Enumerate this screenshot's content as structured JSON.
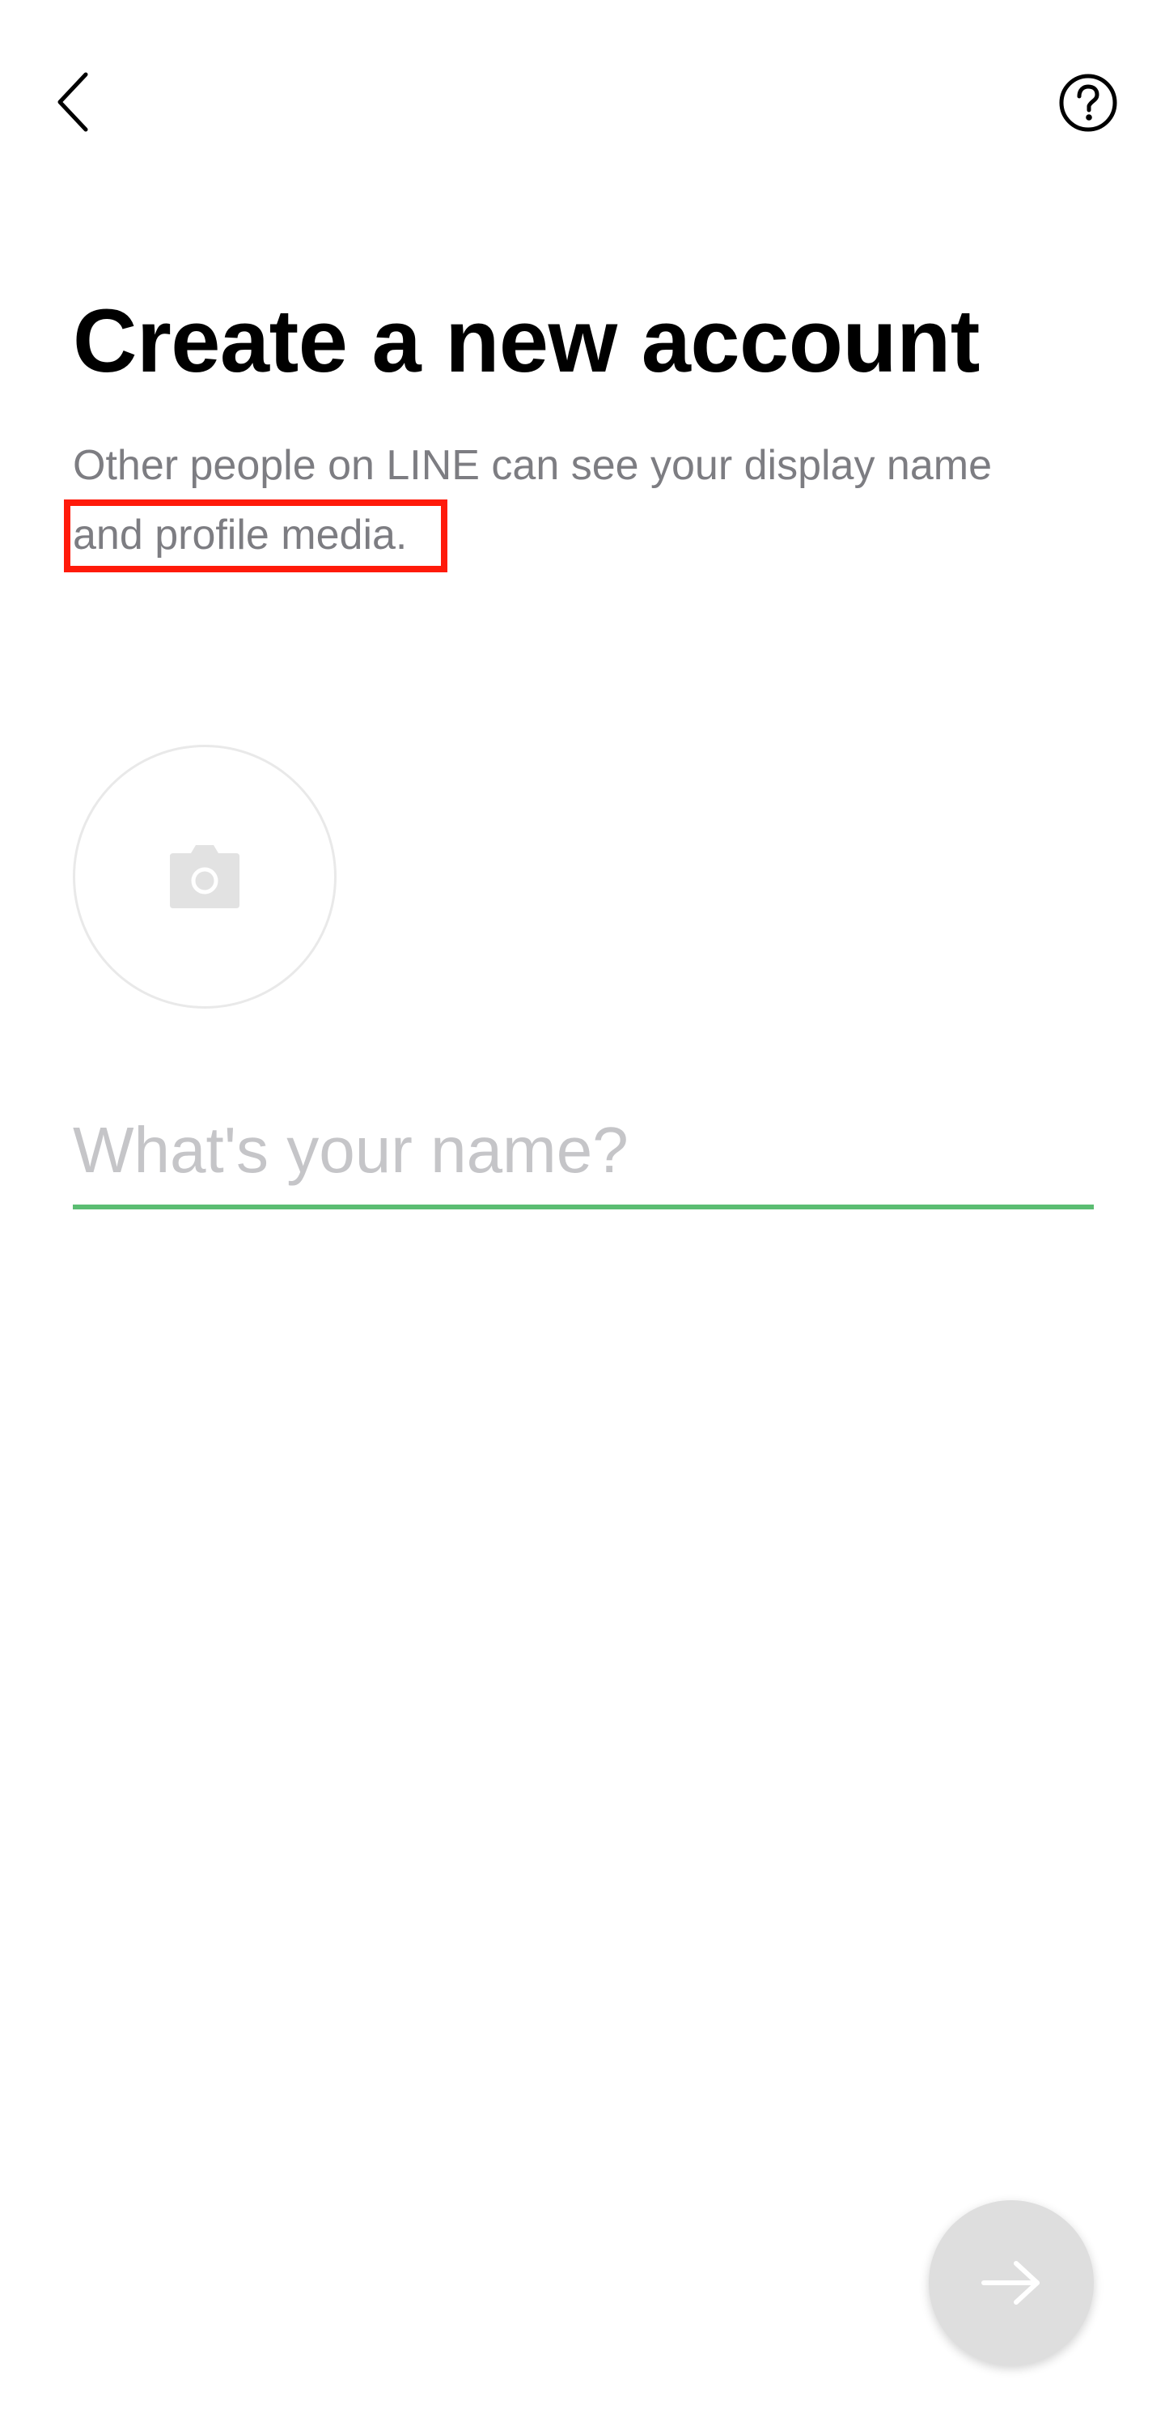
{
  "header": {
    "back_icon": "chevron-left-icon",
    "help_icon": "question-circle-icon"
  },
  "title": "Create a new account",
  "subtitle": {
    "line1": "Other people on LINE can see your display name",
    "line2": "and profile media."
  },
  "avatar": {
    "icon": "camera-icon"
  },
  "name_field": {
    "value": "",
    "placeholder": "What's your name?"
  },
  "next_button": {
    "icon": "arrow-right-icon",
    "enabled": false
  },
  "colors": {
    "accent_green": "#5bbd72",
    "annotation_red": "#ff1a0a",
    "subtitle_gray": "#7d7d82",
    "placeholder_gray": "#c5c5c8",
    "disabled_button": "#dedede"
  }
}
